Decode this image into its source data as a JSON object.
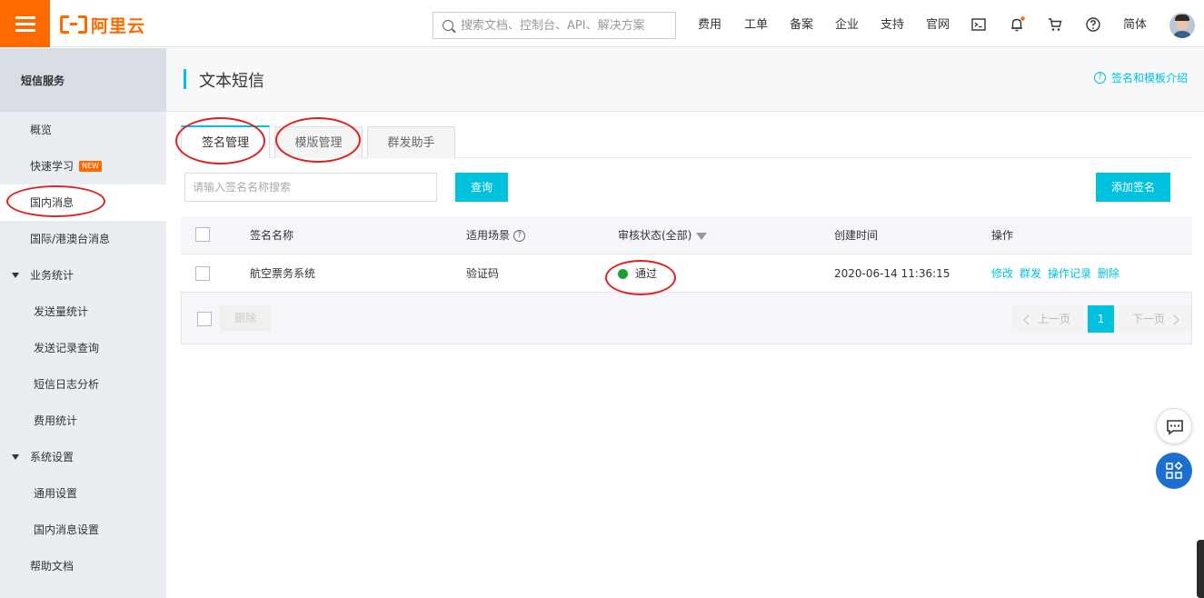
{
  "topbar": {
    "logo_text": "阿里云",
    "search_placeholder": "搜索文档、控制台、API、解决方案",
    "nav": [
      "费用",
      "工单",
      "备案",
      "企业",
      "支持",
      "官网"
    ],
    "lang": "简体"
  },
  "sidebar": {
    "header": "短信服务",
    "items": [
      {
        "label": "概览"
      },
      {
        "label": "快速学习",
        "badge": "NEW"
      },
      {
        "label": "国内消息"
      },
      {
        "label": "国际/港澳台消息"
      },
      {
        "label": "业务统计"
      },
      {
        "label": "发送量统计"
      },
      {
        "label": "发送记录查询"
      },
      {
        "label": "短信日志分析"
      },
      {
        "label": "费用统计"
      },
      {
        "label": "系统设置"
      },
      {
        "label": "通用设置"
      },
      {
        "label": "国内消息设置"
      },
      {
        "label": "帮助文档"
      }
    ]
  },
  "page": {
    "title": "文本短信",
    "help_link": "签名和模板介绍"
  },
  "tabs": [
    {
      "label": "签名管理"
    },
    {
      "label": "模版管理"
    },
    {
      "label": "群发助手"
    }
  ],
  "filter": {
    "placeholder": "请输入签名名称搜索",
    "query_button": "查询",
    "add_button": "添加签名"
  },
  "table": {
    "headers": {
      "name": "签名名称",
      "scene": "适用场景",
      "status": "审核状态(全部)",
      "created": "创建时间",
      "ops": "操作"
    },
    "rows": [
      {
        "name": "航空票务系统",
        "scene": "验证码",
        "status": "通过",
        "created": "2020-06-14 11:36:15",
        "ops": [
          "修改",
          "群发",
          "操作记录",
          "删除"
        ]
      }
    ]
  },
  "footer": {
    "delete_button": "删除",
    "prev": "上一页",
    "page": "1",
    "next": "下一页"
  },
  "colors": {
    "brand": "#ff6a00",
    "accent": "#00c1de",
    "status_ok": "#1e9e30",
    "annotation": "#e02020"
  }
}
